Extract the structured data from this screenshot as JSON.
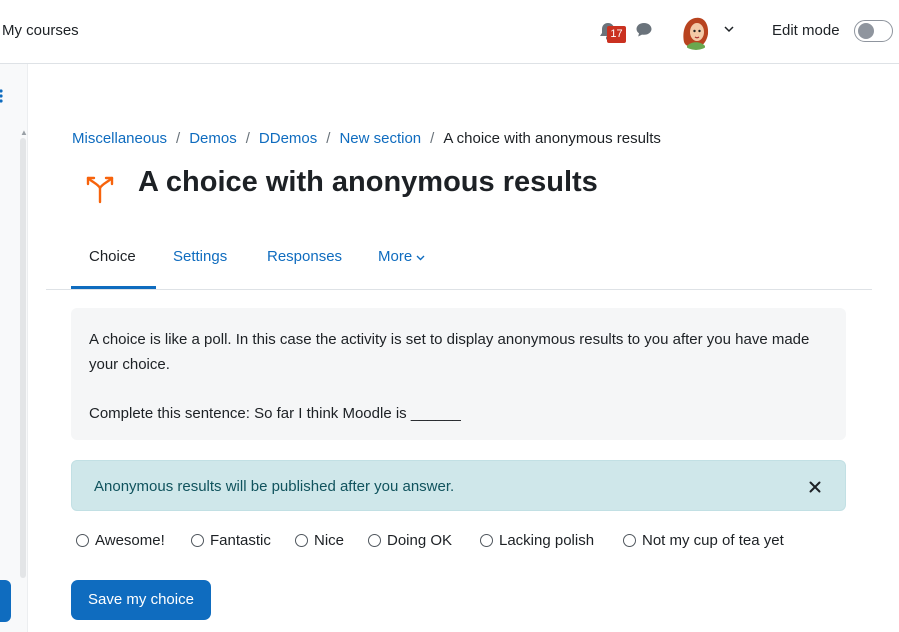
{
  "navbar": {
    "my_courses": "My courses",
    "notification_count": "17",
    "edit_mode_label": "Edit mode",
    "edit_mode_on": false
  },
  "breadcrumb": {
    "items": [
      "Miscellaneous",
      "Demos",
      "DDemos",
      "New section"
    ],
    "current": "A choice with anonymous results"
  },
  "page": {
    "title": "A choice with anonymous results",
    "icon": "choice-icon",
    "icon_color": "#f7630c"
  },
  "tabs": [
    {
      "label": "Choice",
      "active": true
    },
    {
      "label": "Settings",
      "active": false
    },
    {
      "label": "Responses",
      "active": false
    },
    {
      "label": "More",
      "active": false
    }
  ],
  "intro": {
    "paragraph1": "A choice is like a poll. In this case the activity is set to display anonymous results to you after you have made your choice.",
    "paragraph2": "Complete this sentence: So far I think Moodle is ______"
  },
  "alert": {
    "text": "Anonymous results will be published after you answer."
  },
  "options": [
    {
      "label": "Awesome!"
    },
    {
      "label": "Fantastic"
    },
    {
      "label": "Nice"
    },
    {
      "label": "Doing OK"
    },
    {
      "label": "Lacking polish"
    },
    {
      "label": "Not my cup of tea yet"
    }
  ],
  "save_button": "Save my choice",
  "colors": {
    "primary": "#0f6cbf",
    "alert_bg": "#cfe7ea",
    "badge": "#ca3120"
  }
}
